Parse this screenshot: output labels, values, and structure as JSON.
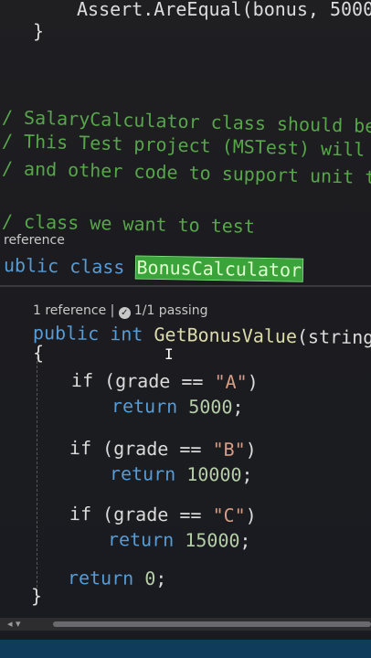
{
  "code": {
    "top_assert": "Assert.AreEqual(bonus, 5000",
    "top_brace": "}",
    "comment1": "/ SalaryCalculator class should be",
    "comment2": "/ This Test project (MSTest) will c",
    "comment3": "/ and other code to support unit te",
    "comment4": "/ class we want to test",
    "class_ref": "reference",
    "class_kw_pub": "ublic",
    "class_kw_class": "class",
    "class_name": "BonusCalculator",
    "method_lens_ref": "1 reference |",
    "method_lens_pass": "1/1 passing",
    "method_kw_public": "public",
    "method_kw_int": "int",
    "method_name": "GetBonusValue",
    "method_params": "(string gr",
    "open_brace": "{",
    "if1": "if (grade == ",
    "if1_str": "\"A\"",
    "if1_close": ")",
    "ret1": "return",
    "ret1_val": "5000",
    "if2": "if (grade == ",
    "if2_str": "\"B\"",
    "if2_close": ")",
    "ret2": "return",
    "ret2_val": "10000",
    "if3": "if (grade == ",
    "if3_str": "\"C\"",
    "if3_close": ")",
    "ret3": "return",
    "ret3_val": "15000",
    "ret4": "return",
    "ret4_val": "0",
    "close_brace": "}",
    "semicolon": ";"
  },
  "colors": {
    "keyword": "#569cd6",
    "type": "#4ec9b0",
    "method": "#dcdcaa",
    "string": "#d69d85",
    "number": "#b5cea8",
    "comment": "#57a64a",
    "highlight": "#3aa33a"
  },
  "icons": {
    "passing": "check-circle-icon"
  }
}
